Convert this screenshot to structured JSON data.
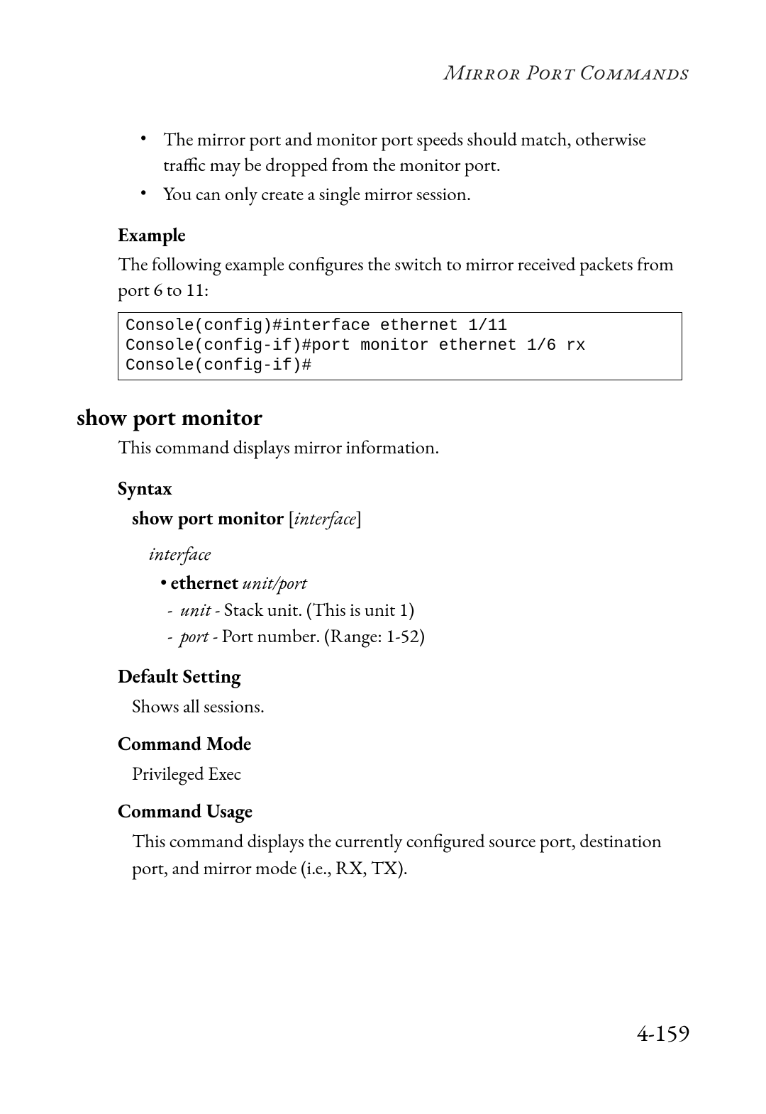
{
  "header": {
    "running": "Mirror Port Commands"
  },
  "top_bullets": [
    "The mirror port and monitor port speeds should match, otherwise traffic may be dropped from the monitor port.",
    "You can only create a single mirror session."
  ],
  "example": {
    "heading": "Example",
    "intro": "The following example configures the switch to mirror received packets from port 6 to 11:",
    "code": "Console(config)#interface ethernet 1/11\nConsole(config-if)#port monitor ethernet 1/6 rx\nConsole(config-if)#"
  },
  "command": {
    "title": "show port monitor",
    "description": "This command displays mirror information.",
    "syntax": {
      "heading": "Syntax",
      "cmd_bold": "show port monitor",
      "cmd_rest_open": " [",
      "cmd_arg": "interface",
      "cmd_rest_close": "]",
      "arg_name": "interface",
      "ethernet_label": "ethernet",
      "ethernet_arg1": "unit",
      "ethernet_sep": "/",
      "ethernet_arg2": "port",
      "unit_label": "unit",
      "unit_desc": " - Stack unit. (This is unit 1)",
      "port_label": "port",
      "port_desc": " - Port number. (Range: 1-52)"
    },
    "default_setting": {
      "heading": "Default Setting",
      "value": "Shows all sessions."
    },
    "command_mode": {
      "heading": "Command Mode",
      "value": "Privileged Exec"
    },
    "command_usage": {
      "heading": "Command Usage",
      "value": "This command displays the currently configured source port, destination port, and mirror mode (i.e., RX, TX)."
    }
  },
  "page_number": "4-159"
}
